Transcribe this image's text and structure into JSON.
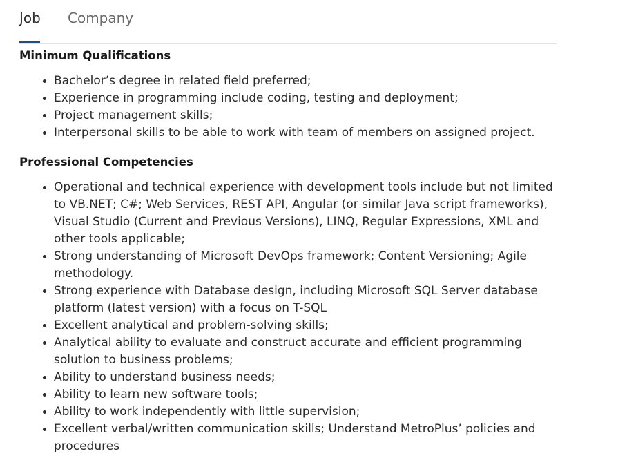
{
  "tabs": [
    {
      "label": "Job",
      "active": true
    },
    {
      "label": "Company",
      "active": false
    }
  ],
  "colors": {
    "active_underline": "#1b4e8e",
    "text": "#2b2b2b",
    "muted_tab": "#6b6b6b"
  },
  "sections": [
    {
      "heading": "Minimum Qualifications",
      "items": [
        "Bachelor’s degree in related field preferred;",
        "Experience in programming include coding, testing and deployment;",
        "Project management skills;",
        "Interpersonal skills to be able to work with team of members on assigned project."
      ]
    },
    {
      "heading": "Professional Competencies",
      "items": [
        "Operational and technical experience with development tools include but not limited to VB.NET; C#; Web Services, REST API, Angular (or similar Java script frameworks), Visual Studio (Current and Previous Versions), LINQ, Regular Expressions, XML and other tools applicable;",
        "Strong understanding of Microsoft DevOps framework; Content Versioning; Agile methodology.",
        "Strong experience with Database design, including Microsoft SQL Server database platform (latest version) with a focus on T-SQL",
        "Excellent analytical and problem-solving skills;",
        "Analytical ability to evaluate and construct accurate and efficient programming solution to business problems;",
        "Ability to understand business needs;",
        "Ability to learn new software tools;",
        "Ability to work independently with little supervision;",
        "Excellent verbal/written communication skills; Understand MetroPlus’ policies and procedures"
      ]
    }
  ]
}
